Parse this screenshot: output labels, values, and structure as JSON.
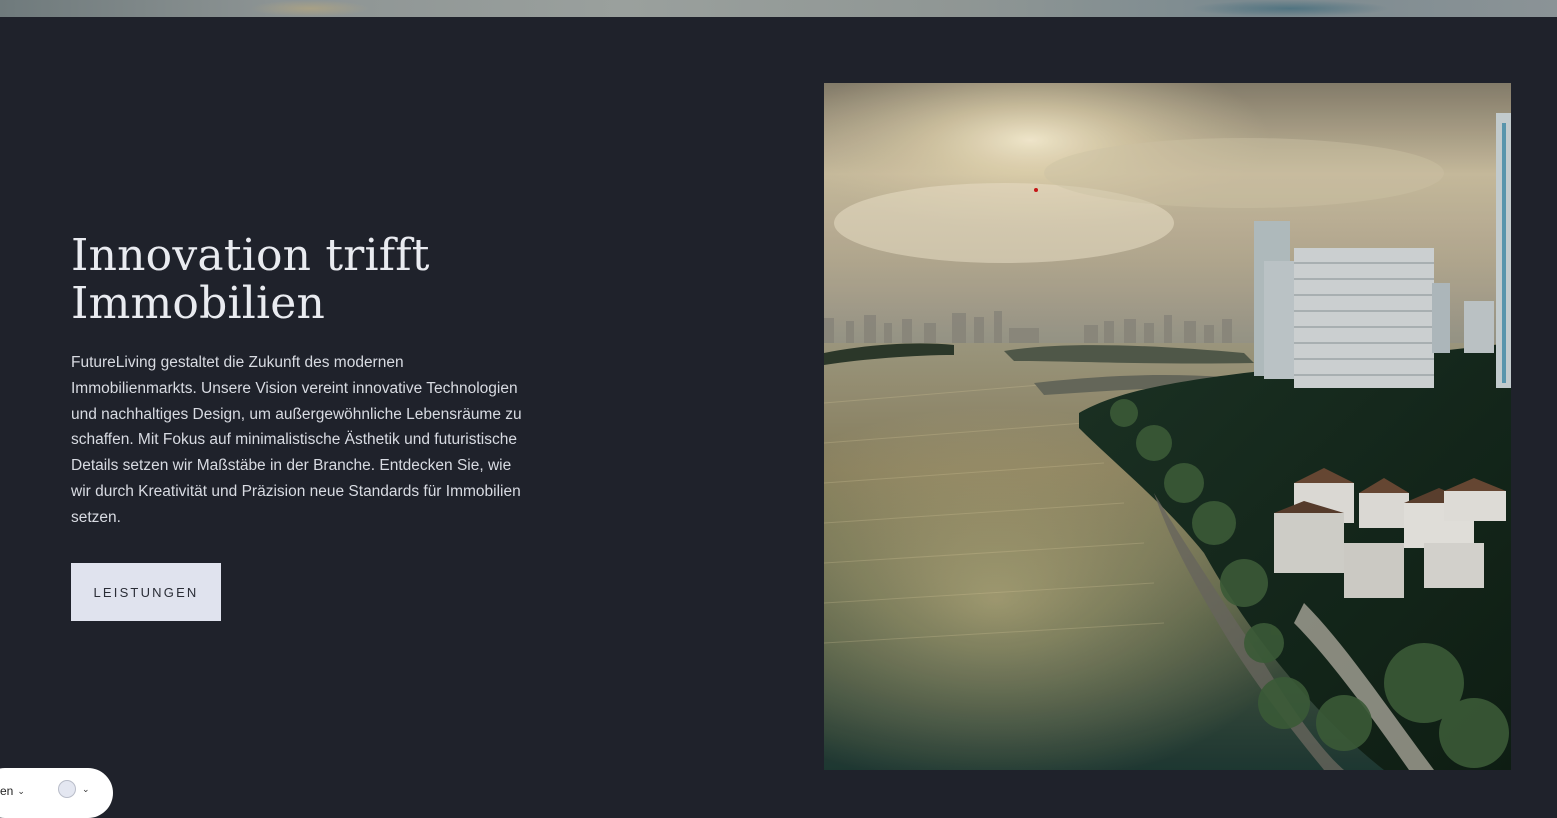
{
  "hero": {
    "title_line1": "Innovation trifft",
    "title_line2": "Immobilien",
    "body": "FutureLiving gestaltet die Zukunft des modernen Immobilienmarkts. Unsere Vision vereint innovative Technologien und nachhaltiges Design, um außergewöhnliche Lebensräume zu schaffen. Mit Fokus auf minimalistische Ästhetik und futuristische Details setzen wir Maßstäbe in der Branche. Entdecken Sie, wie wir durch Kreativität und Präzision neue Standards für Immobilien setzen.",
    "cta_label": "LEISTUNGEN"
  },
  "widget": {
    "language_label": "ren",
    "language_icon": "chevron-down-icon",
    "accessibility_icon": "circle-icon"
  },
  "colors": {
    "background": "#1f222b",
    "title": "#e9ebf0",
    "body": "#d8dbe2",
    "button_bg": "#e0e3ee",
    "button_text": "#2a2d36"
  }
}
